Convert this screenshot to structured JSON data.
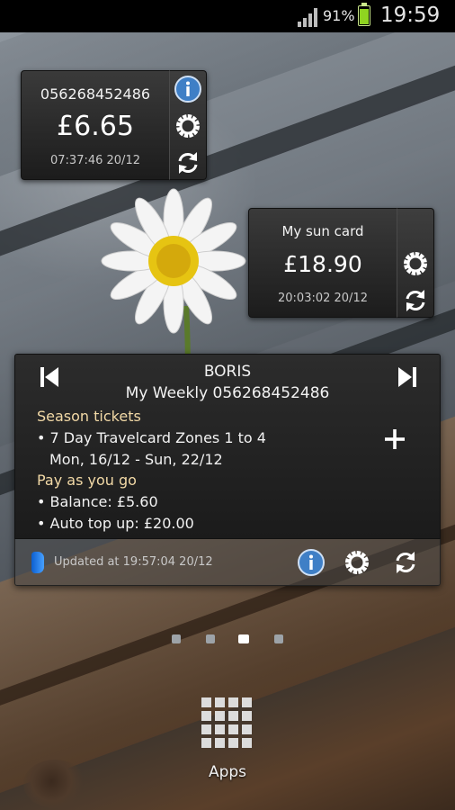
{
  "status_bar": {
    "battery_percent": "91%",
    "battery_level": 0.91,
    "time": "19:59",
    "icons": [
      "signal-icon",
      "battery-icon"
    ]
  },
  "widget1": {
    "name": "056268452486",
    "amount": "£6.65",
    "updated": "07:37:46 20/12",
    "icons": [
      "info-icon",
      "settings-icon",
      "refresh-icon"
    ]
  },
  "widget2": {
    "name": "My sun card",
    "amount": "£18.90",
    "updated": "20:03:02 20/12",
    "icons": [
      "settings-icon",
      "refresh-icon"
    ]
  },
  "big_widget": {
    "title": "BORIS",
    "subtitle": "My Weekly 056268452486",
    "season_header": "Season tickets",
    "season_line1": "• 7 Day Travelcard Zones 1 to 4",
    "season_line2": "Mon, 16/12 - Sun, 22/12",
    "payg_header": "Pay as you go",
    "payg_balance": "• Balance: £5.60",
    "payg_topup": "• Auto top up: £20.00",
    "updated": "Updated at 19:57:04 20/12",
    "icons": [
      "previous-icon",
      "next-icon",
      "add-icon",
      "oyster-card-icon",
      "info-icon",
      "settings-icon",
      "refresh-icon"
    ]
  },
  "home": {
    "pages": 4,
    "active_page": 3,
    "apps_label": "Apps",
    "apps_icon": "apps-grid-icon"
  },
  "colors": {
    "section_header": "#f2d9a6",
    "info_blue": "#3f7fc6",
    "battery_green": "#8fd420"
  }
}
